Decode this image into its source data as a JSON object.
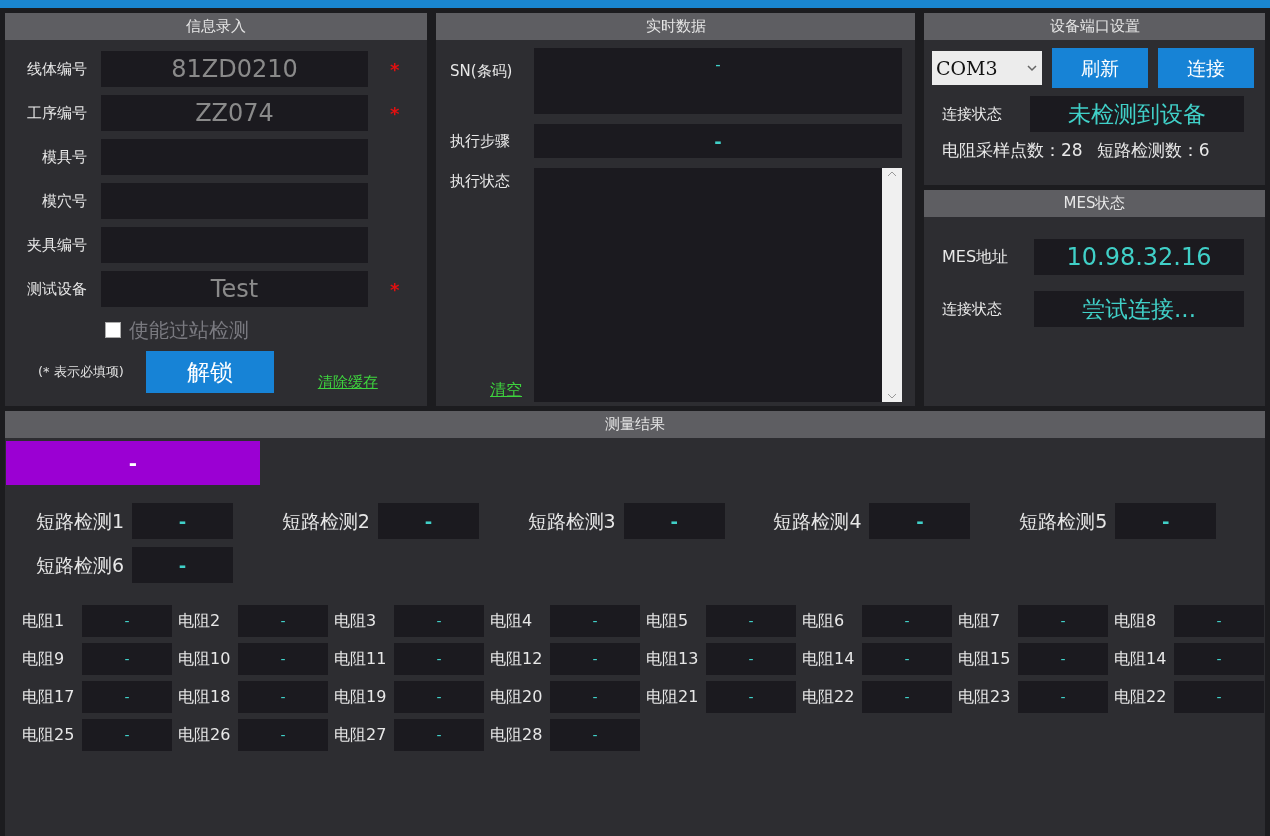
{
  "info_entry": {
    "title": "信息录入",
    "fields": [
      {
        "label": "线体编号",
        "value": "81ZD0210",
        "mark": "*"
      },
      {
        "label": "工序编号",
        "value": "ZZ074",
        "mark": "*"
      },
      {
        "label": "模具号"
      },
      {
        "label": "模穴号"
      },
      {
        "label": "夹具编号"
      },
      {
        "label": "测试设备",
        "value": "Test",
        "mark": "*"
      }
    ],
    "checkbox": {
      "label": "使能过站检测",
      "checked": false,
      "disabled": true
    },
    "note": "(* 表示必填项)",
    "unlock_button": "解锁",
    "clear_cache_link": "清除缓存"
  },
  "realtime": {
    "title": "实时数据",
    "sn": {
      "label": "SN(条码)",
      "value": "-"
    },
    "step": {
      "label": "执行步骤",
      "value": "-"
    },
    "status": {
      "label": "执行状态"
    },
    "clear_link": "清空"
  },
  "port_settings": {
    "title": "设备端口设置",
    "port": "COM3",
    "buttons": [
      "刷新",
      "连接"
    ],
    "status_label": "连接状态",
    "status_value": "未检测到设备",
    "sample_count": "电阻采样点数：28",
    "short_count": "短路检测数：6"
  },
  "mes": {
    "title": "MES状态",
    "address_label": "MES地址",
    "address_value": "10.98.32.16",
    "status_label": "连接状态",
    "status_value": "尝试连接..."
  },
  "results": {
    "title": "测量结果",
    "overall": {
      "value": "-",
      "color": "#9b00d3"
    },
    "short_tests": [
      {
        "label": "短路检测1",
        "value": "-"
      },
      {
        "label": "短路检测2",
        "value": "-"
      },
      {
        "label": "短路检测3",
        "value": "-"
      },
      {
        "label": "短路检测4",
        "value": "-"
      },
      {
        "label": "短路检测5",
        "value": "-"
      },
      {
        "label": "短路检测6",
        "value": "-"
      }
    ],
    "resistances": [
      {
        "label": "电阻1",
        "value": "-"
      },
      {
        "label": "电阻2",
        "value": "-"
      },
      {
        "label": "电阻3",
        "value": "-"
      },
      {
        "label": "电阻4",
        "value": "-"
      },
      {
        "label": "电阻5",
        "value": "-"
      },
      {
        "label": "电阻6",
        "value": "-"
      },
      {
        "label": "电阻7",
        "value": "-"
      },
      {
        "label": "电阻8",
        "value": "-"
      },
      {
        "label": "电阻9",
        "value": "-"
      },
      {
        "label": "电阻10",
        "value": "-"
      },
      {
        "label": "电阻11",
        "value": "-"
      },
      {
        "label": "电阻12",
        "value": "-"
      },
      {
        "label": "电阻13",
        "value": "-"
      },
      {
        "label": "电阻14",
        "value": "-"
      },
      {
        "label": "电阻15",
        "value": "-"
      },
      {
        "label": "电阻14",
        "value": "-"
      },
      {
        "label": "电阻17",
        "value": "-"
      },
      {
        "label": "电阻18",
        "value": "-"
      },
      {
        "label": "电阻19",
        "value": "-"
      },
      {
        "label": "电阻20",
        "value": "-"
      },
      {
        "label": "电阻21",
        "value": "-"
      },
      {
        "label": "电阻22",
        "value": "-"
      },
      {
        "label": "电阻23",
        "value": "-"
      },
      {
        "label": "电阻22",
        "value": "-"
      },
      {
        "label": "电阻25",
        "value": "-"
      },
      {
        "label": "电阻26",
        "value": "-"
      },
      {
        "label": "电阻27",
        "value": "-"
      },
      {
        "label": "电阻28",
        "value": "-"
      }
    ]
  }
}
